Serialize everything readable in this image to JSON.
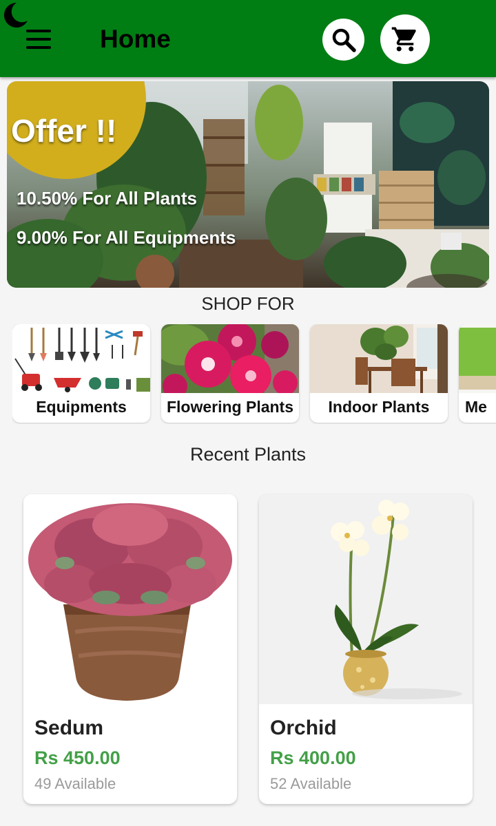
{
  "appbar": {
    "title": "Home",
    "color": "#007e13",
    "icons": {
      "menu": "hamburger-icon",
      "search": "search-icon",
      "cart": "shopping-cart-icon",
      "theme": "moon-icon"
    }
  },
  "banner": {
    "title": "Offer !!",
    "lines": [
      "10.50% For All Plants",
      "9.00% For All Equipments"
    ],
    "badge_color": "#d2ae1d"
  },
  "shop_for": {
    "title": "SHOP FOR",
    "categories": [
      {
        "label": "Equipments"
      },
      {
        "label": "Flowering Plants"
      },
      {
        "label": "Indoor Plants"
      },
      {
        "label": "Me"
      }
    ]
  },
  "recent": {
    "title": "Recent Plants",
    "products": [
      {
        "name": "Sedum",
        "price": "Rs 450.00",
        "stock": "49 Available"
      },
      {
        "name": "Orchid",
        "price": "Rs 400.00",
        "stock": "52 Available"
      }
    ],
    "price_color": "#43a047"
  }
}
